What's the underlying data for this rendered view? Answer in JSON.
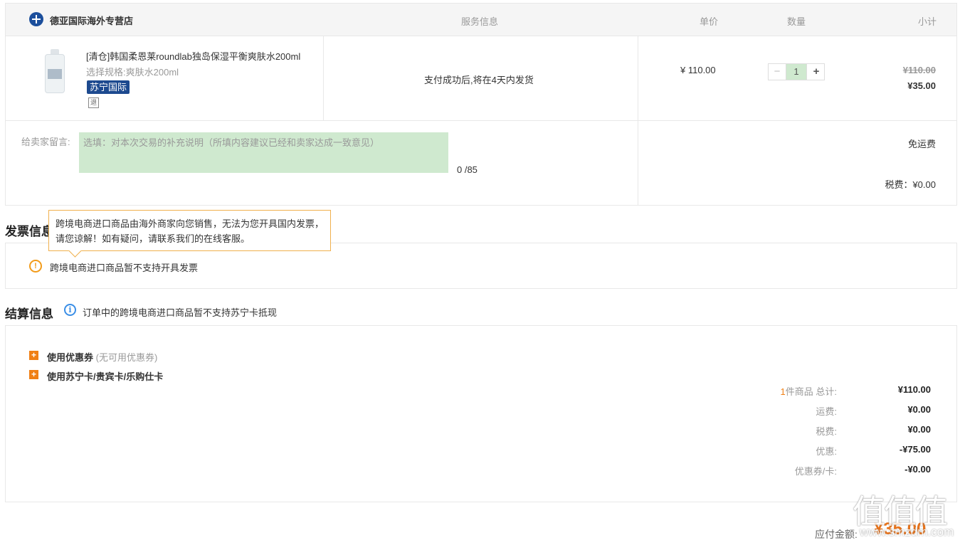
{
  "order": {
    "store_name": "德亚国际海外专营店",
    "col_service": "服务信息",
    "col_price": "单价",
    "col_qty": "数量",
    "col_subtotal": "小计",
    "product": {
      "title": "[清仓]韩国柔恩莱roundlab独岛保湿平衡爽肤水200ml",
      "spec_label": "选择规格:",
      "spec_value": "爽肤水200ml",
      "badge": "苏宁国际",
      "refund_icon": "退",
      "service": "支付成功后,将在4天内发货",
      "price": "¥ 110.00",
      "qty_minus": "−",
      "qty": "1",
      "qty_plus": "+",
      "old_subtotal": "¥110.00",
      "subtotal": "¥35.00"
    },
    "message_label": "给卖家留言:",
    "message_placeholder": "选填：对本次交易的补充说明（所填内容建议已经和卖家达成一致意见）",
    "message_count": "0 /85",
    "shipping": "免运费",
    "tax": "税费：¥0.00"
  },
  "invoice": {
    "title": "发票信息",
    "tooltip": "跨境电商进口商品由海外商家向您销售，无法为您开具国内发票，请您谅解！如有疑问，请联系我们的在线客服。",
    "warn_icon": "!",
    "text": "跨境电商进口商品暂不支持开具发票"
  },
  "settlement": {
    "title": "结算信息",
    "info_icon": "i",
    "note": "订单中的跨境电商进口商品暂不支持苏宁卡抵现",
    "coupon_label": "使用优惠券",
    "coupon_note": "(无可用优惠券)",
    "card_label": "使用苏宁卡/贵宾卡/乐购仕卡",
    "count_num": "1",
    "summary": [
      {
        "label": "件商品 总计:",
        "value": "¥110.00"
      },
      {
        "label": "运费:",
        "value": "¥0.00"
      },
      {
        "label": "税费:",
        "value": "¥0.00"
      },
      {
        "label": "优惠:",
        "value": "-¥75.00"
      },
      {
        "label": "优惠券/卡:",
        "value": "-¥0.00"
      }
    ],
    "pay_label": "应付金额:",
    "pay_amount": "¥35.00"
  },
  "watermark": {
    "logo": "值值值",
    "url": "www.smzdm.com"
  },
  "colors": {
    "accent_orange": "#f07f14",
    "brand_blue": "#1d4a8f",
    "input_green": "#cfe9cf"
  }
}
